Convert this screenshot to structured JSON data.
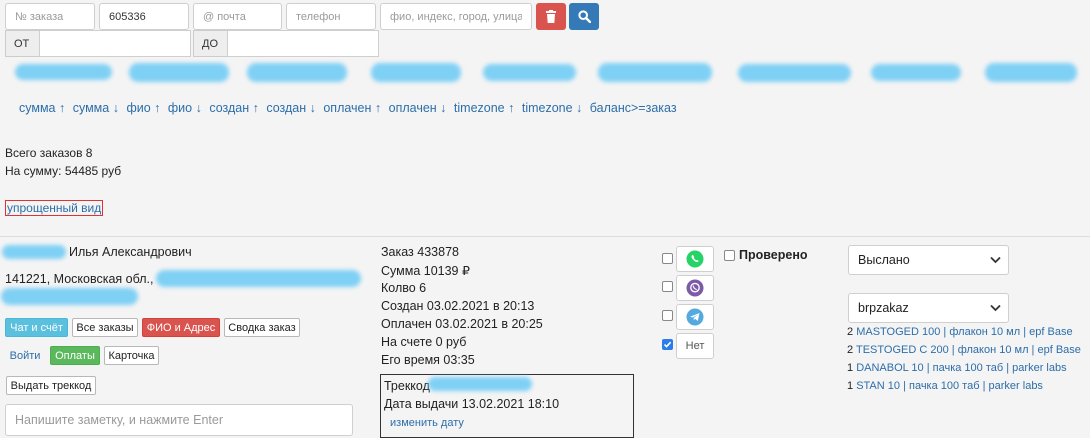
{
  "search": {
    "order_no_placeholder": "№ заказа",
    "order_no_value": "605336",
    "email_placeholder": "@ почта",
    "phone_placeholder": "телефон",
    "address_placeholder": "фио, индекс, город, улица",
    "from_label": "ОТ",
    "to_label": "ДО"
  },
  "sort_links": [
    "сумма ↑",
    "сумма ↓",
    "фио ↑",
    "фио ↓",
    "создан ↑",
    "создан ↓",
    "оплачен ↑",
    "оплачен ↓",
    "timezone ↑",
    "timezone ↓",
    "баланс>=заказ"
  ],
  "summary": {
    "total_orders": "Всего заказов 8",
    "total_sum": "На сумму: 54485 руб",
    "simple_view": "упрощенный вид"
  },
  "customer": {
    "name": "Илья Александрович",
    "address": "141221, Московская обл.,"
  },
  "buttons": {
    "chat": "Чат и счёт",
    "all_orders": "Все заказы",
    "fio_address": "ФИО и Адрес",
    "summary_order": "Сводка заказ",
    "login": "Войти",
    "payments": "Оплаты",
    "card": "Карточка",
    "issue_track": "Выдать треккод"
  },
  "note_placeholder": "Напишите заметку, и нажмите Enter",
  "order": {
    "number": "Заказ 433878",
    "sum": "Сумма 10139 ₽",
    "qty": "Колво 6",
    "created": "Создан 03.02.2021 в 20:13",
    "paid": "Оплачен 03.02.2021 в 20:25",
    "balance": "На счете 0 руб",
    "time": "Его время 03:35"
  },
  "track": {
    "label": "Треккод",
    "issue_date": "Дата выдачи 13.02.2021 18:10",
    "change_date": "изменить дату"
  },
  "messengers": {
    "no_label": "Нет",
    "whatsapp_color": "#25d366",
    "viber_color": "#7d5aa8",
    "telegram_color": "#54a9de"
  },
  "checked": {
    "label": "Проверено"
  },
  "status": {
    "selected": "Выслано"
  },
  "shop": {
    "selected": "brpzakaz"
  },
  "products": [
    {
      "qty": "2",
      "name": "MASTOGED 100",
      "pack": "флакон 10 мл",
      "brand": "epf Base"
    },
    {
      "qty": "2",
      "name": "TESTOGED C 200",
      "pack": "флакон 10 мл",
      "brand": "epf Base"
    },
    {
      "qty": "1",
      "name": "DANABOL 10",
      "pack": "пачка 100 таб",
      "brand": "parker labs"
    },
    {
      "qty": "1",
      "name": "STAN 10",
      "pack": "пачка 100 таб",
      "brand": "parker labs"
    }
  ],
  "colors": {
    "link": "#2d6ea9",
    "danger": "#d9534f",
    "primary": "#337ab7",
    "redaction": "#7fd0f5"
  }
}
